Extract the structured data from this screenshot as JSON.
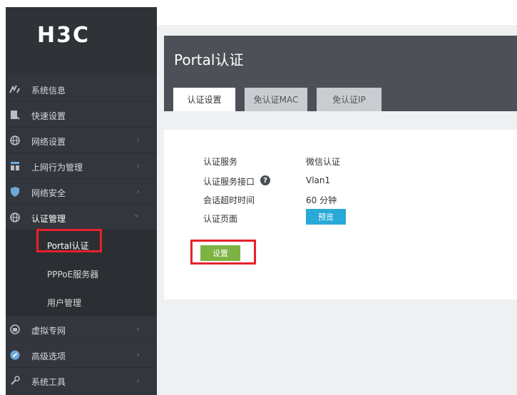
{
  "brand": {
    "logo_text": "H3C"
  },
  "sidebar": {
    "items": [
      {
        "label": "系统信息",
        "icon": "dashboard-icon"
      },
      {
        "label": "快速设置",
        "icon": "quick-setup-icon"
      },
      {
        "label": "网络设置",
        "icon": "globe-icon"
      },
      {
        "label": "上网行为管理",
        "icon": "behavior-icon"
      },
      {
        "label": "网络安全",
        "icon": "shield-icon"
      },
      {
        "label": "认证管理",
        "icon": "globe-icon"
      },
      {
        "label": "虚拟专网",
        "icon": "vpn-icon"
      },
      {
        "label": "高级选项",
        "icon": "advanced-icon"
      },
      {
        "label": "系统工具",
        "icon": "tools-icon"
      }
    ],
    "sub_items": [
      {
        "label": "Portal认证"
      },
      {
        "label": "PPPoE服务器"
      },
      {
        "label": "用户管理"
      }
    ],
    "chevron_right": "›",
    "chevron_down": "⌄"
  },
  "page": {
    "title": "Portal认证",
    "tabs": [
      {
        "label": "认证设置"
      },
      {
        "label": "免认证MAC"
      },
      {
        "label": "免认证IP"
      }
    ],
    "fields": {
      "auth_service_label": "认证服务",
      "auth_service_value": "微信认证",
      "auth_interface_label": "认证服务接口",
      "auth_interface_value": "Vlan1",
      "session_timeout_label": "会话超时时间",
      "session_timeout_value": "60 分钟",
      "auth_page_label": "认证页面"
    },
    "preview_label": "预览",
    "settings_label": "设置",
    "help_glyph": "?"
  },
  "colors": {
    "sidebar_bg": "#33373d",
    "header_bg": "#4d5157",
    "preview_button": "#29a9d8",
    "settings_button": "#7cb342",
    "highlight_border": "#e8202a"
  }
}
